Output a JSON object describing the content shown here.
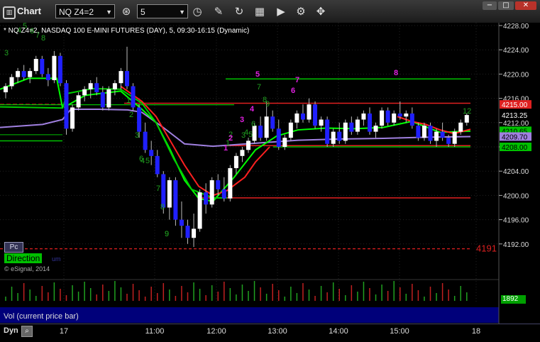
{
  "window": {
    "title": "Chart",
    "logo_icon": "chart-window-icon",
    "symbol": "NQ Z4=2",
    "interval": "5",
    "toolbar_icons": [
      "link-icon",
      "clock-icon",
      "pencil-icon",
      "refresh-icon",
      "calculator-icon",
      "play-icon",
      "gear-icon"
    ],
    "buttons": {
      "minimize": "−",
      "maximize": "□",
      "close": "✕"
    }
  },
  "header": {
    "text": "* NQ Z4=2, NASDAQ 100 E-MINI FUTURES (DAY), 5, 09:30-16:15 (Dynamic)"
  },
  "price_axis": {
    "ticks": [
      "4228.00",
      "4224.00",
      "4220.00",
      "4216.00",
      "4212.00",
      "4208.00",
      "4204.00",
      "4200.00",
      "4196.00",
      "4192.00"
    ],
    "badges": [
      {
        "value": "4215.00",
        "color": "#e02020",
        "text_color": "#ffffff"
      },
      {
        "value": "4213.25",
        "color": "#000000",
        "text_color": "#ffffff"
      },
      {
        "value": "4210.65",
        "color": "#00c000",
        "text_color": "#000000"
      },
      {
        "value": "4209.70",
        "color": "#a080e0",
        "text_color": "#000000"
      },
      {
        "value": "4208.00",
        "color": "#00c000",
        "text_color": "#000000"
      }
    ],
    "low_label": "4191"
  },
  "x_axis": {
    "labels": [
      "17",
      "11:00",
      "12:00",
      "13:00",
      "14:00",
      "15:00",
      "18"
    ]
  },
  "overlays": {
    "pc_tag": "Pc",
    "direction_tag": "Direction",
    "copyright": "© eSignal, 2014",
    "volume_label": "Vol (current price bar)",
    "volume_value": "1892",
    "dyn_label": "Dyn",
    "dyn_icon": "zoom-icon"
  },
  "colors": {
    "bull_candle": "#ffffff",
    "bear_candle": "#2020ff",
    "resistance_line": "#e02020",
    "support_line": "#00c000",
    "ma_fast": "#00ff00",
    "ma_red": "#ff2020",
    "ma_purple": "#a080e0",
    "count_green": "#20a020",
    "count_magenta": "#e020e0"
  },
  "sequence_counts": {
    "green": [
      "3",
      "4",
      "5",
      "6",
      "7",
      "8",
      "9",
      "1",
      "2",
      "3",
      "6",
      "4",
      "5",
      "7",
      "8",
      "9",
      "1",
      "2",
      "3",
      "4",
      "5",
      "6",
      "7",
      "8",
      "9",
      "12"
    ],
    "magenta": [
      "1",
      "2",
      "3",
      "4",
      "5",
      "6",
      "7",
      "8"
    ]
  }
}
